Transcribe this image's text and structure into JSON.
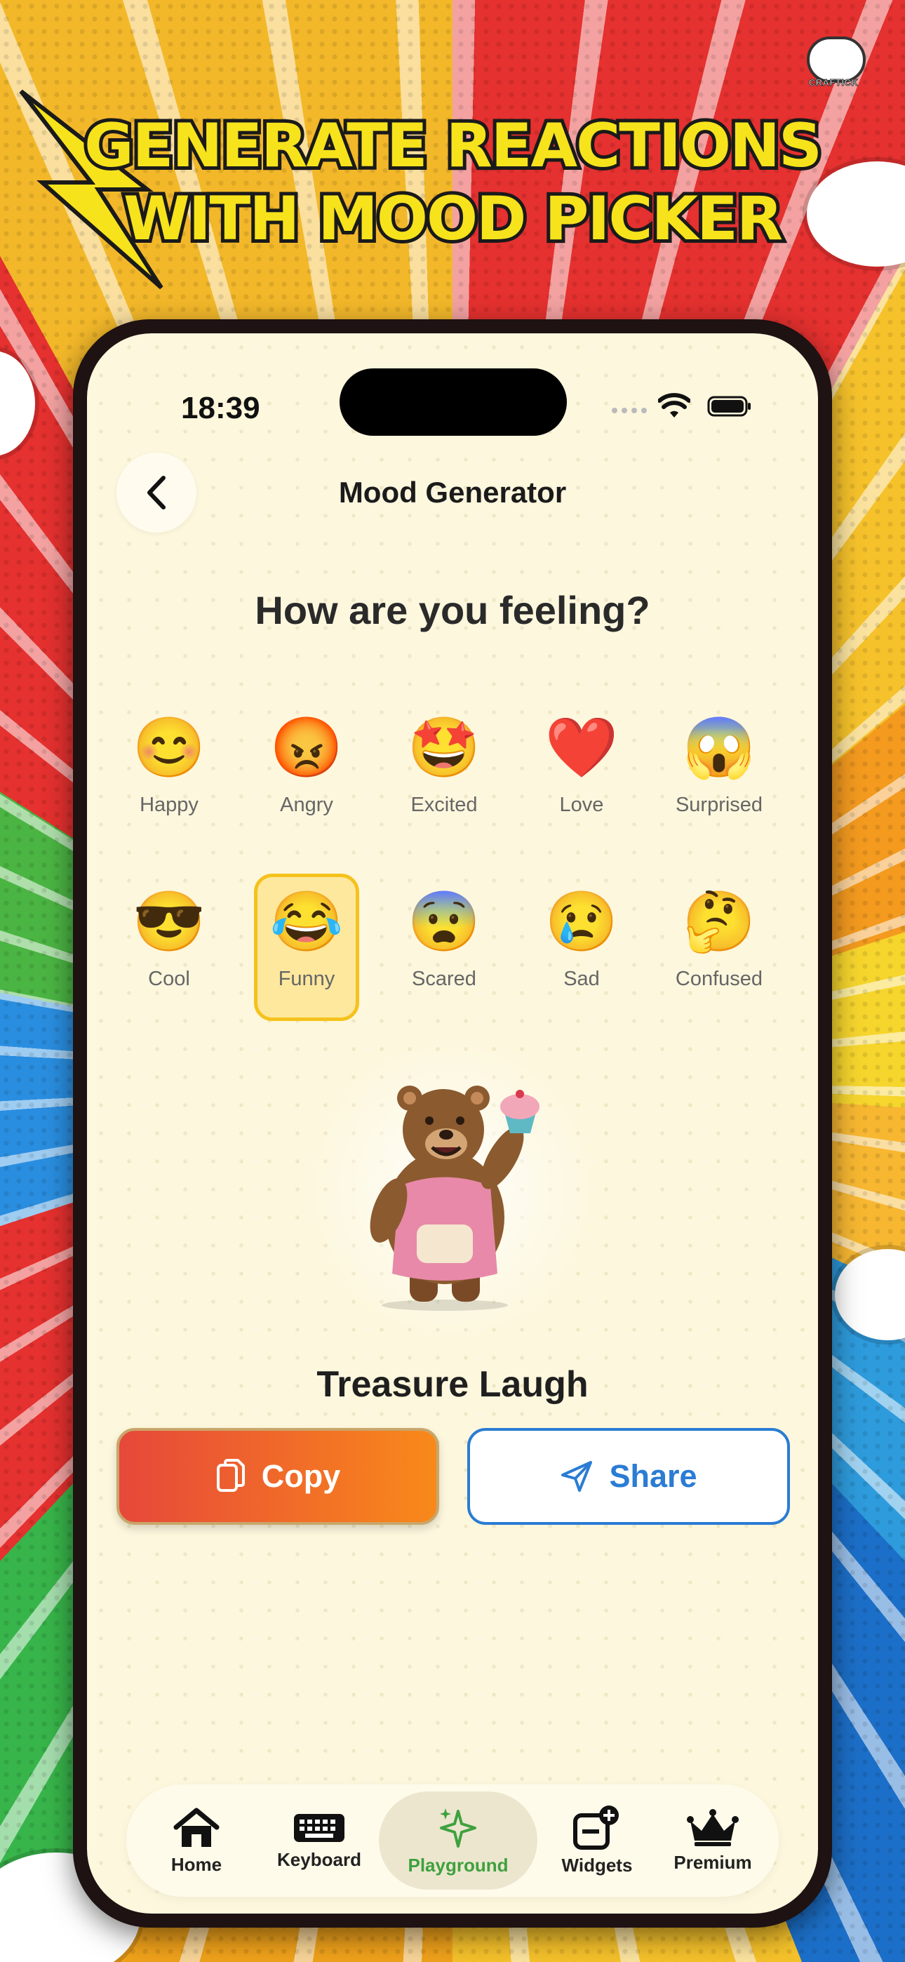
{
  "promo": {
    "headline_line1": "GENERATE REACTIONS",
    "headline_line2": "WITH MOOD PICKER",
    "logo_text": "CRAFTICK"
  },
  "status_bar": {
    "time": "18:39"
  },
  "nav": {
    "title": "Mood Generator",
    "back_icon": "chevron-left-icon"
  },
  "main": {
    "question": "How are you feeling?",
    "moods": [
      {
        "label": "Happy",
        "emoji": "😊"
      },
      {
        "label": "Angry",
        "emoji": "😡"
      },
      {
        "label": "Excited",
        "emoji": "🤩"
      },
      {
        "label": "Love",
        "emoji": "❤️"
      },
      {
        "label": "Surprised",
        "emoji": "😱"
      },
      {
        "label": "Cool",
        "emoji": "😎"
      },
      {
        "label": "Funny",
        "emoji": "😂"
      },
      {
        "label": "Scared",
        "emoji": "😨"
      },
      {
        "label": "Sad",
        "emoji": "😢"
      },
      {
        "label": "Confused",
        "emoji": "🤔"
      }
    ],
    "selected_mood": "Funny",
    "result_title": "Treasure Laugh",
    "copy_label": "Copy",
    "share_label": "Share"
  },
  "tabbar": {
    "items": [
      {
        "label": "Home",
        "icon": "home-icon"
      },
      {
        "label": "Keyboard",
        "icon": "keyboard-icon"
      },
      {
        "label": "Playground",
        "icon": "sparkles-icon"
      },
      {
        "label": "Widgets",
        "icon": "widget-add-icon"
      },
      {
        "label": "Premium",
        "icon": "crown-icon"
      }
    ],
    "active": "Playground"
  },
  "colors": {
    "accent_orange": "#f9891a",
    "accent_red": "#e6483a",
    "share_blue": "#2a7cd4",
    "active_green": "#3ea13e",
    "selected_yellow": "#f5c21d"
  }
}
